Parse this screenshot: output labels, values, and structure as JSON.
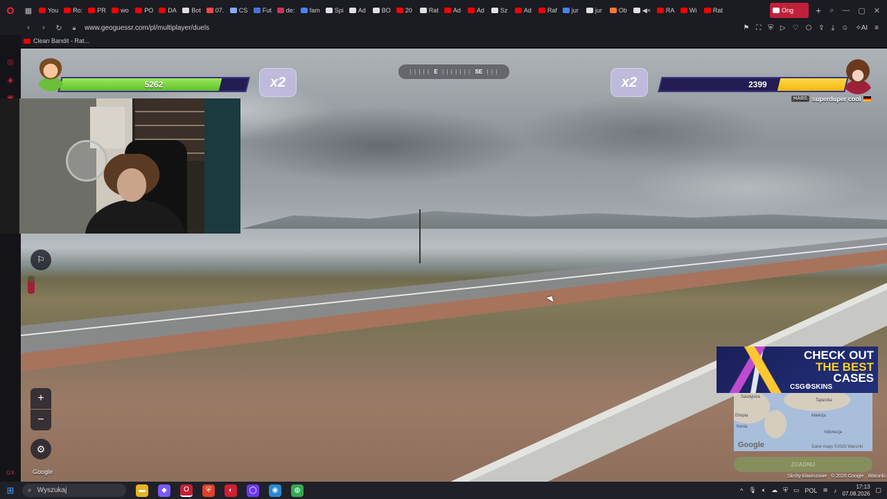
{
  "browser": {
    "tabs": [
      {
        "label": "You",
        "color": "#ff0000"
      },
      {
        "label": "Ro:",
        "color": "#ff0000"
      },
      {
        "label": "PR",
        "color": "#ff0000"
      },
      {
        "label": "wo",
        "color": "#ff0000"
      },
      {
        "label": "PO",
        "color": "#ff0000"
      },
      {
        "label": "DA",
        "color": "#ff0000"
      },
      {
        "label": "Bot",
        "color": "#e0e0e0"
      },
      {
        "label": "07.",
        "color": "#ff4444"
      },
      {
        "label": "CS",
        "color": "#88aaff"
      },
      {
        "label": "Fut",
        "color": "#4477dd"
      },
      {
        "label": "de:",
        "color": "#cc3355"
      },
      {
        "label": "fam",
        "color": "#4285f4"
      },
      {
        "label": "Spi",
        "color": "#e0e0e0"
      },
      {
        "label": "Ad",
        "color": "#e0e0e0"
      },
      {
        "label": "BO",
        "color": "#e0e0e0"
      },
      {
        "label": "20",
        "color": "#ff0000"
      },
      {
        "label": "Rat",
        "color": "#e0e0e0"
      },
      {
        "label": "Ad",
        "color": "#ff0000"
      },
      {
        "label": "Ad",
        "color": "#ff0000"
      },
      {
        "label": "Sz",
        "color": "#e0e0e0"
      },
      {
        "label": "Ad",
        "color": "#ff0000"
      },
      {
        "label": "Raf",
        "color": "#ff0000"
      },
      {
        "label": "jur",
        "color": "#4285f4"
      },
      {
        "label": "jur",
        "color": "#e0e0e0"
      },
      {
        "label": "Ob",
        "color": "#ff7733"
      },
      {
        "label": "◀×",
        "color": "#e0e0e0"
      },
      {
        "label": "RA",
        "color": "#ff0000"
      },
      {
        "label": "Wi",
        "color": "#ff0000"
      },
      {
        "label": "Rat",
        "color": "#ff0000"
      }
    ],
    "active_tab": "Ong",
    "url": "www.geoguessr.com/pl/multiplayer/duels",
    "bookmark": "Clean Bandit - Rat..."
  },
  "hud": {
    "left_health": "5262",
    "right_health": "2399",
    "left_multiplier": "x2",
    "right_multiplier": "x2",
    "compass_left": "E",
    "compass_right": "SE",
    "opponent_tag": "HABS",
    "opponent_name": "superduper cool"
  },
  "map_controls": {
    "zoom_in": "+",
    "zoom_out": "−",
    "google_label": "Google"
  },
  "ad": {
    "line1": "CHECK OUT",
    "line2": "THE BEST",
    "line3": "CASES",
    "brand": "CSG⚙SKINS"
  },
  "minimap": {
    "labels": [
      "Saudyjska",
      "Etiopia",
      "Kenia",
      "Tajlandia",
      "Malezja",
      "Indonezja"
    ],
    "google": "Google",
    "attribution": "Dane mapy ©2025  Warunki",
    "guess_button": "ZGADNIJ"
  },
  "attribution": {
    "shortcuts": "Skróty klawiszowe",
    "copyright": "© 2026 Google",
    "terms": "Warunki"
  },
  "taskbar": {
    "search_placeholder": "Wyszukaj",
    "language": "POL",
    "time": "17:13",
    "date": "07.08.2026"
  }
}
